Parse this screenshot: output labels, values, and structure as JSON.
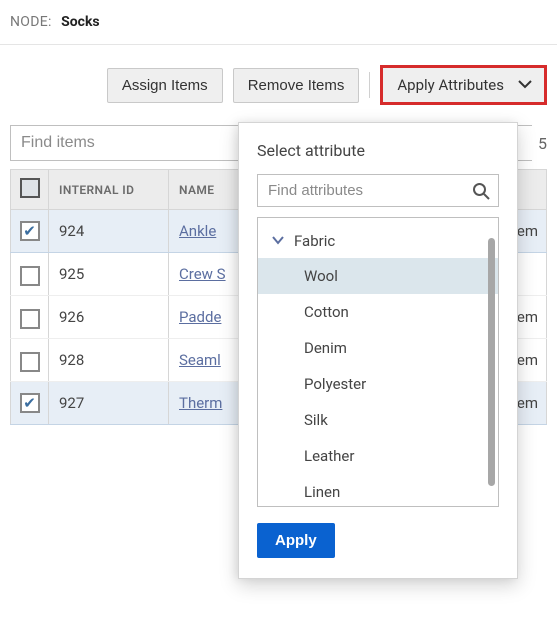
{
  "header": {
    "node_label": "NODE:",
    "node_title": "Socks"
  },
  "toolbar": {
    "assign_label": "Assign Items",
    "remove_label": "Remove Items",
    "apply_attr_label": "Apply Attributes"
  },
  "search": {
    "placeholder": "Find items",
    "right_trunc": "5"
  },
  "table": {
    "columns": {
      "internal_id": "INTERNAL ID",
      "name": "NAME"
    },
    "right_trunc_cell": "em",
    "rows": [
      {
        "checked": true,
        "id": "924",
        "name": "Ankle",
        "trunc": "em"
      },
      {
        "checked": false,
        "id": "925",
        "name": "Crew S",
        "trunc": ""
      },
      {
        "checked": false,
        "id": "926",
        "name": "Padde",
        "trunc": "em"
      },
      {
        "checked": false,
        "id": "928",
        "name": "Seaml",
        "trunc": "em"
      },
      {
        "checked": true,
        "id": "927",
        "name": "Therm",
        "trunc": "em"
      }
    ]
  },
  "popover": {
    "title": "Select attribute",
    "search_placeholder": "Find attributes",
    "group": "Fabric",
    "items": [
      "Wool",
      "Cotton",
      "Denim",
      "Polyester",
      "Silk",
      "Leather",
      "Linen"
    ],
    "selected": "Wool",
    "apply_label": "Apply"
  }
}
